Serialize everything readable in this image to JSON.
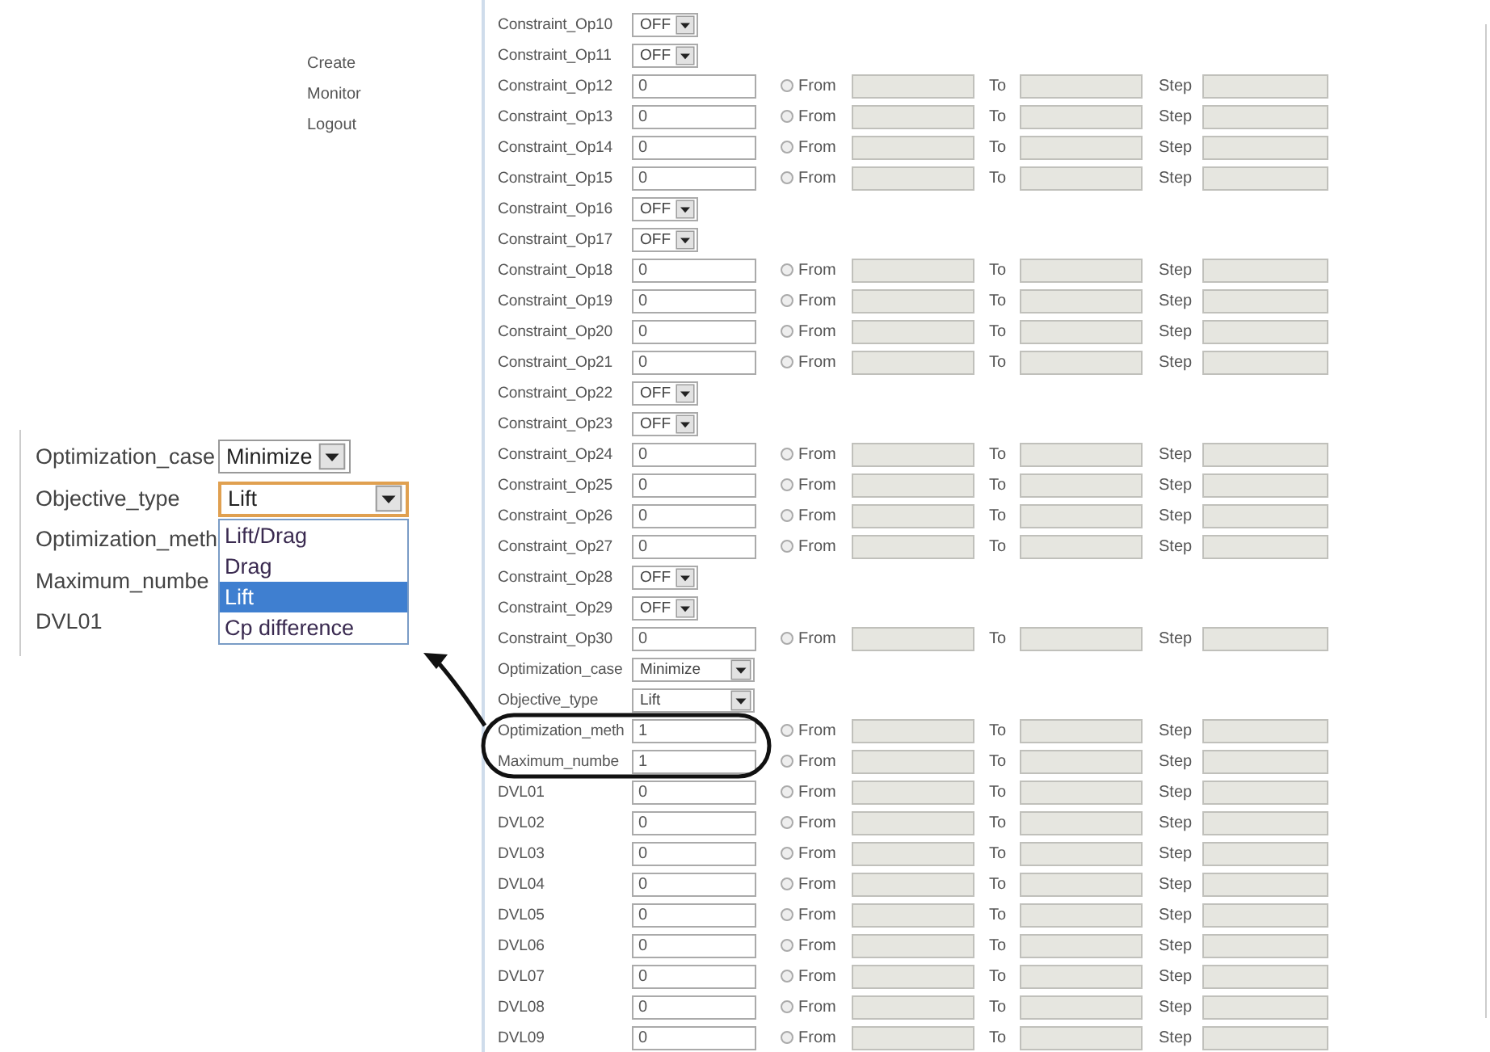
{
  "nav": [
    {
      "label": "Create"
    },
    {
      "label": "Monitor"
    },
    {
      "label": "Logout"
    }
  ],
  "rows": [
    {
      "kind": "toggle",
      "label": "Constraint_Op10",
      "value": "OFF"
    },
    {
      "kind": "toggle",
      "label": "Constraint_Op11",
      "value": "OFF"
    },
    {
      "kind": "range",
      "label": "Constraint_Op12",
      "value": "0",
      "selected": false,
      "from": "From",
      "to": "To",
      "step": "Step"
    },
    {
      "kind": "range",
      "label": "Constraint_Op13",
      "value": "0",
      "selected": false,
      "from": "From",
      "to": "To",
      "step": "Step"
    },
    {
      "kind": "range",
      "label": "Constraint_Op14",
      "value": "0",
      "selected": false,
      "from": "From",
      "to": "To",
      "step": "Step"
    },
    {
      "kind": "range",
      "label": "Constraint_Op15",
      "value": "0",
      "selected": false,
      "from": "From",
      "to": "To",
      "step": "Step"
    },
    {
      "kind": "toggle",
      "label": "Constraint_Op16",
      "value": "OFF"
    },
    {
      "kind": "toggle",
      "label": "Constraint_Op17",
      "value": "OFF"
    },
    {
      "kind": "range",
      "label": "Constraint_Op18",
      "value": "0",
      "selected": false,
      "from": "From",
      "to": "To",
      "step": "Step"
    },
    {
      "kind": "range",
      "label": "Constraint_Op19",
      "value": "0",
      "selected": false,
      "from": "From",
      "to": "To",
      "step": "Step"
    },
    {
      "kind": "range",
      "label": "Constraint_Op20",
      "value": "0",
      "selected": false,
      "from": "From",
      "to": "To",
      "step": "Step"
    },
    {
      "kind": "range",
      "label": "Constraint_Op21",
      "value": "0",
      "selected": false,
      "from": "From",
      "to": "To",
      "step": "Step"
    },
    {
      "kind": "toggle",
      "label": "Constraint_Op22",
      "value": "OFF"
    },
    {
      "kind": "toggle",
      "label": "Constraint_Op23",
      "value": "OFF"
    },
    {
      "kind": "range",
      "label": "Constraint_Op24",
      "value": "0",
      "selected": false,
      "from": "From",
      "to": "To",
      "step": "Step"
    },
    {
      "kind": "range",
      "label": "Constraint_Op25",
      "value": "0",
      "selected": false,
      "from": "From",
      "to": "To",
      "step": "Step"
    },
    {
      "kind": "range",
      "label": "Constraint_Op26",
      "value": "0",
      "selected": false,
      "from": "From",
      "to": "To",
      "step": "Step"
    },
    {
      "kind": "range",
      "label": "Constraint_Op27",
      "value": "0",
      "selected": false,
      "from": "From",
      "to": "To",
      "step": "Step"
    },
    {
      "kind": "toggle",
      "label": "Constraint_Op28",
      "value": "OFF"
    },
    {
      "kind": "toggle",
      "label": "Constraint_Op29",
      "value": "OFF"
    },
    {
      "kind": "range",
      "label": "Constraint_Op30",
      "value": "0",
      "selected": false,
      "from": "From",
      "to": "To",
      "step": "Step"
    },
    {
      "kind": "choice",
      "label": "Optimization_case",
      "value": "Minimize"
    },
    {
      "kind": "choice",
      "label": "Objective_type",
      "value": "Lift"
    },
    {
      "kind": "range",
      "label": "Optimization_meth",
      "value": "1",
      "selected": false,
      "from": "From",
      "to": "To",
      "step": "Step"
    },
    {
      "kind": "range",
      "label": "Maximum_numbe",
      "value": "1",
      "selected": false,
      "from": "From",
      "to": "To",
      "step": "Step"
    },
    {
      "kind": "range",
      "label": "DVL01",
      "value": "0",
      "selected": false,
      "from": "From",
      "to": "To",
      "step": "Step"
    },
    {
      "kind": "range",
      "label": "DVL02",
      "value": "0",
      "selected": false,
      "from": "From",
      "to": "To",
      "step": "Step"
    },
    {
      "kind": "range",
      "label": "DVL03",
      "value": "0",
      "selected": false,
      "from": "From",
      "to": "To",
      "step": "Step"
    },
    {
      "kind": "range",
      "label": "DVL04",
      "value": "0",
      "selected": false,
      "from": "From",
      "to": "To",
      "step": "Step"
    },
    {
      "kind": "range",
      "label": "DVL05",
      "value": "0",
      "selected": false,
      "from": "From",
      "to": "To",
      "step": "Step"
    },
    {
      "kind": "range",
      "label": "DVL06",
      "value": "0",
      "selected": false,
      "from": "From",
      "to": "To",
      "step": "Step"
    },
    {
      "kind": "range",
      "label": "DVL07",
      "value": "0",
      "selected": false,
      "from": "From",
      "to": "To",
      "step": "Step"
    },
    {
      "kind": "range",
      "label": "DVL08",
      "value": "0",
      "selected": false,
      "from": "From",
      "to": "To",
      "step": "Step"
    },
    {
      "kind": "range",
      "label": "DVL09",
      "value": "0",
      "selected": false,
      "from": "From",
      "to": "To",
      "step": "Step"
    }
  ],
  "callout": {
    "rows": [
      {
        "kind": "select",
        "label": "Optimization_case",
        "value": "Minimize"
      },
      {
        "kind": "open_select",
        "label": "Objective_type",
        "value": "Lift",
        "options": [
          {
            "label": "Lift/Drag",
            "selected": false
          },
          {
            "label": "Drag",
            "selected": false
          },
          {
            "label": "Lift",
            "selected": true
          },
          {
            "label": "Cp difference",
            "selected": false
          }
        ]
      },
      {
        "kind": "label",
        "label": "Optimization_meth"
      },
      {
        "kind": "label",
        "label": "Maximum_numbe"
      },
      {
        "kind": "label",
        "label": "DVL01"
      }
    ]
  }
}
